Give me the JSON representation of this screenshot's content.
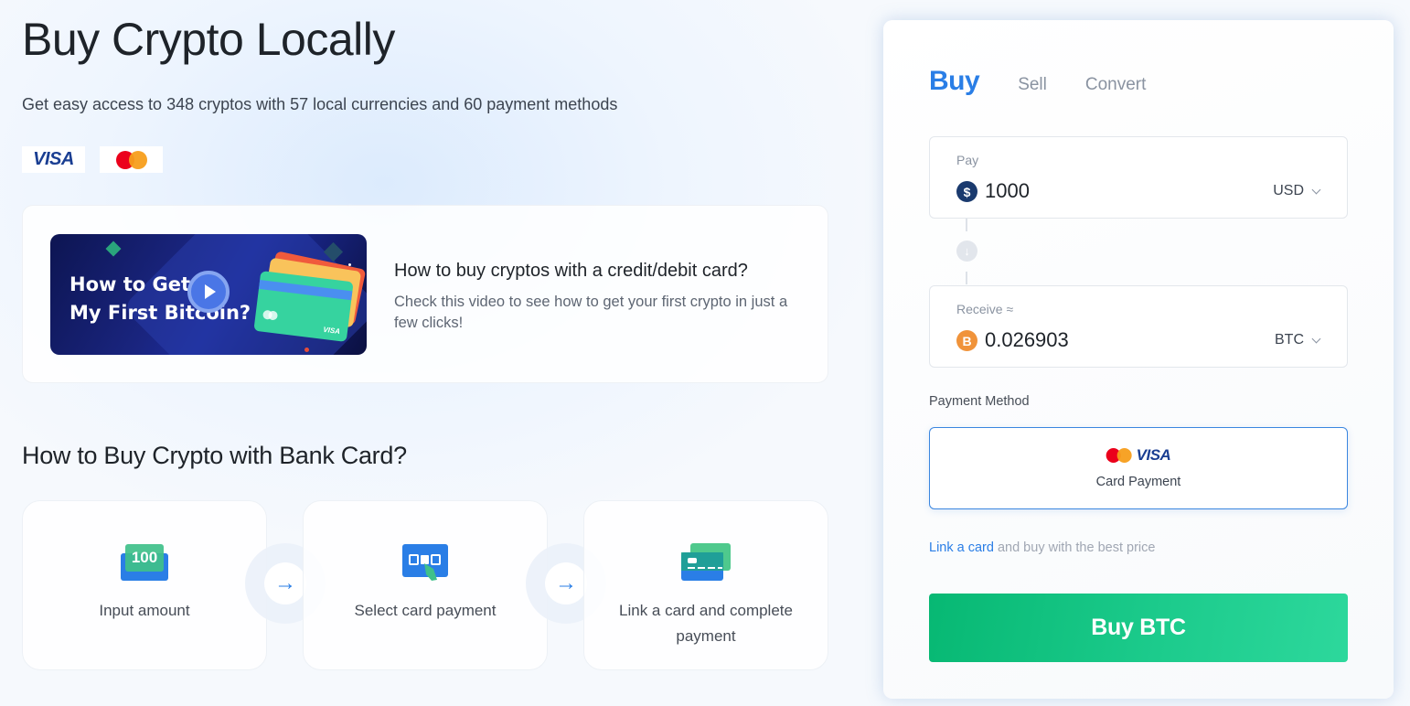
{
  "hero": {
    "title": "Buy Crypto Locally",
    "subtitle": "Get easy access to 348 cryptos with 57 local currencies and 60 payment methods",
    "payment_logos": [
      "visa-logo",
      "mastercard-logo"
    ],
    "visa_text": "VISA"
  },
  "video_card": {
    "thumbnail_line1": "How to Get",
    "thumbnail_line2": "My First Bitcoin?",
    "thumbnail_card_brand": "VISA",
    "title": "How to buy cryptos with a credit/debit card?",
    "description": "Check this video to see how to get your first crypto in just a few clicks!"
  },
  "how_to": {
    "title": "How to Buy Crypto with Bank Card?",
    "steps": [
      {
        "label": "Input amount",
        "icon": "cash-100-icon",
        "icon_text": "100"
      },
      {
        "label": "Select card payment",
        "icon": "card-select-icon"
      },
      {
        "label": "Link a card and complete payment",
        "icon": "link-card-icon"
      }
    ],
    "connector_icon": "arrow-right-icon"
  },
  "trade_panel": {
    "tabs": [
      {
        "label": "Buy",
        "active": true
      },
      {
        "label": "Sell",
        "active": false
      },
      {
        "label": "Convert",
        "active": false
      }
    ],
    "pay": {
      "label": "Pay",
      "value": "1000",
      "currency": "USD",
      "coin_icon": "$"
    },
    "receive": {
      "label": "Receive ≈",
      "value": "0.026903",
      "currency": "BTC",
      "coin_icon": "B"
    },
    "swap_icon": "↓",
    "payment_method": {
      "label": "Payment Method",
      "option_label": "Card Payment",
      "visa_text": "VISA"
    },
    "link_card": {
      "link_text": "Link a card",
      "rest_text": " and buy with the best price"
    },
    "buy_button": "Buy BTC"
  },
  "colors": {
    "accent_blue": "#2a7ee6",
    "buy_green": "#07b873",
    "btc_orange": "#f0933a",
    "usd_navy": "#1a3a6e"
  }
}
